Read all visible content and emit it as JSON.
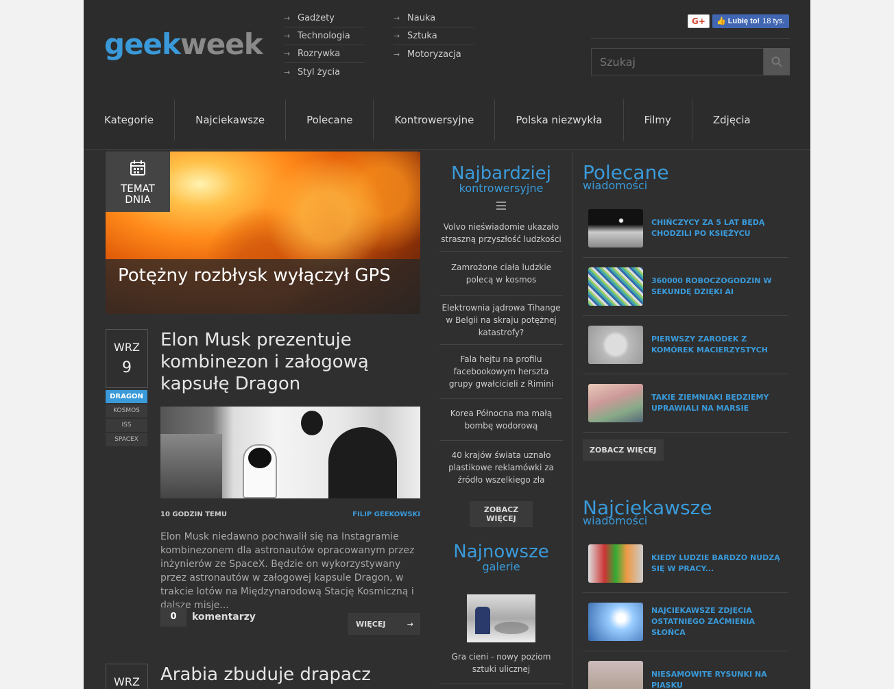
{
  "logo": {
    "part1": "geek",
    "part2": "week"
  },
  "topcats": {
    "col1": [
      "Gadżety",
      "Technologia",
      "Rozrywka",
      "Styl życia"
    ],
    "col2": [
      "Nauka",
      "Sztuka",
      "Motoryzacja"
    ]
  },
  "social": {
    "gplus": "G+",
    "fb_like": "Lubię to!",
    "fb_count": "18 tys."
  },
  "search": {
    "placeholder": "Szukaj"
  },
  "nav": [
    "Kategorie",
    "Najciekawsze",
    "Polecane",
    "Kontrowersyjne",
    "Polska niezwykła",
    "Filmy",
    "Zdjęcia"
  ],
  "featured": {
    "badge_line1": "TEMAT",
    "badge_line2": "DNIA",
    "title": "Potężny rozbłysk wyłączył GPS"
  },
  "article1": {
    "month": "WRZ",
    "day": "9",
    "tags": [
      "DRAGON",
      "KOSMOS",
      "ISS",
      "SPACEX"
    ],
    "title": "Elon Musk prezentuje kombinezon i załogową kapsułę Dragon",
    "time": "10 GODZIN TEMU",
    "author": "FILIP GEEKOWSKI",
    "excerpt": "Elon Musk niedawno pochwalił się na Instagramie kombinezonem dla astronautów opracowanym przez inżynierów ze SpaceX. Będzie on wykorzystywany przez astronautów w załogowej kapsule Dragon, w trakcie lotów na Międzynarodową Stację Kosmiczną i dalsze misje...",
    "comments_count": "0",
    "comments_label": "komentarzy",
    "more": "WIĘCEJ"
  },
  "article2": {
    "month": "WRZ",
    "title": "Arabia zbuduje drapacz"
  },
  "controversial": {
    "title": "Najbardziej",
    "subtitle": "kontrowersyjne",
    "items": [
      "Volvo nieświadomie ukazało straszną przyszłość ludzkości",
      "Zamrożone ciała ludzkie polecą w kosmos",
      "Elektrownia jądrowa Tihange w Belgii na skraju potężnej katastrofy?",
      "Fala hejtu na profilu facebookowym hersztа grupy gwałcicieli z Rimini",
      "Korea Północna ma małą bombę wodorową",
      "40 krajów świata uznało plastikowe reklamówki za źródło wszelkiego zła"
    ],
    "more_line1": "ZOBACZ",
    "more_line2": "WIĘCEJ"
  },
  "galleries": {
    "title": "Najnowsze",
    "subtitle": "galerie",
    "item": "Gra cieni - nowy poziom sztuki ulicznej"
  },
  "recommended": {
    "title": "Polecane",
    "subtitle": "wiadomości",
    "items": [
      "CHIŃCZYCY ZA 5 LAT BĘDĄ CHODZILI PO KSIĘŻYCU",
      "360000 ROBOCZOGODZIN W SEKUNDĘ DZIĘKI AI",
      "PIERWSZY ZARODEK Z KOMÓREK MACIERZYSTYCH",
      "TAKIE ZIEMNIAKI BĘDZIEMY UPRAWIALI NA MARSIE"
    ],
    "more": "ZOBACZ WIĘCEJ"
  },
  "interesting": {
    "title": "Najciekawsze",
    "subtitle": "wiadomości",
    "items": [
      "KIEDY LUDZIE BARDZO NUDZĄ SIĘ W PRACY...",
      "NAJCIEKAWSZE ZDJĘCIA OSTATNIEGO ZAĆMIENIA SŁOŃCA",
      "NIESAMOWITE RYSUNKI NA PIASKU"
    ]
  },
  "colors": {
    "accent": "#3a9ad9",
    "background": "#2f2f2f"
  }
}
